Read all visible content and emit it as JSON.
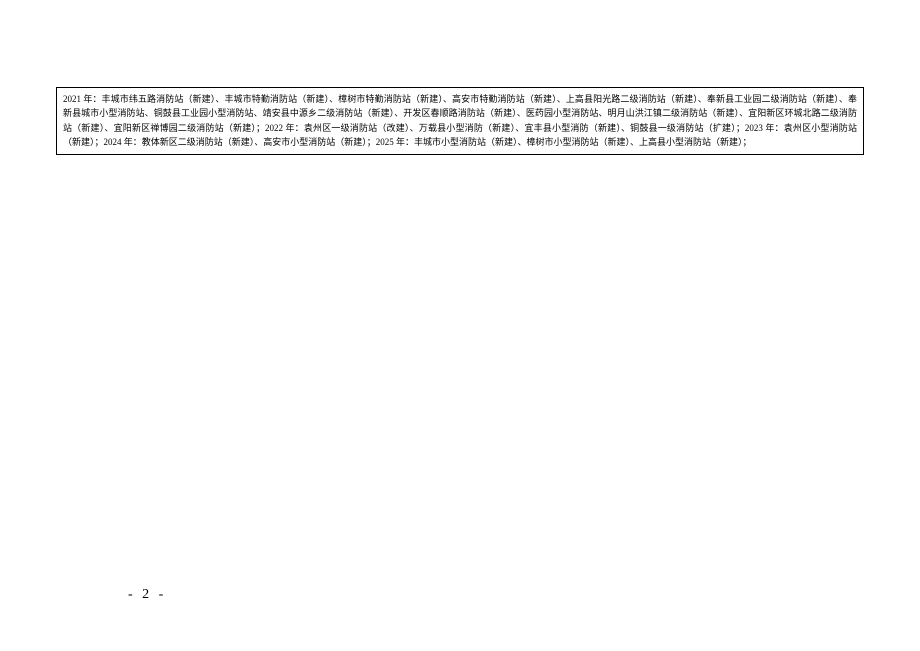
{
  "content": {
    "paragraph": "2021 年：丰城市纬五路消防站（新建）、丰城市特勤消防站（新建）、樟树市特勤消防站（新建）、高安市特勤消防站（新建）、上高县阳光路二级消防站（新建）、奉新县工业园二级消防站（新建）、奉新县城市小型消防站、铜鼓县工业园小型消防站、靖安县中源乡二级消防站（新建）、开发区春顺路消防站（新建）、医药园小型消防站、明月山洪江镇二级消防站（新建）、宜阳新区环城北路二级消防站（新建）、宜阳新区禅博园二级消防站（新建）；2022 年：袁州区一级消防站（改建）、万载县小型消防（新建）、宜丰县小型消防（新建）、铜鼓县一级消防站（扩建）；2023 年：袁州区小型消防站（新建）；2024 年：教体新区二级消防站（新建）、高安市小型消防站（新建）；2025 年：丰城市小型消防站（新建）、樟树市小型消防站（新建）、上高县小型消防站（新建）；"
  },
  "page": {
    "number": "- 2 -"
  }
}
